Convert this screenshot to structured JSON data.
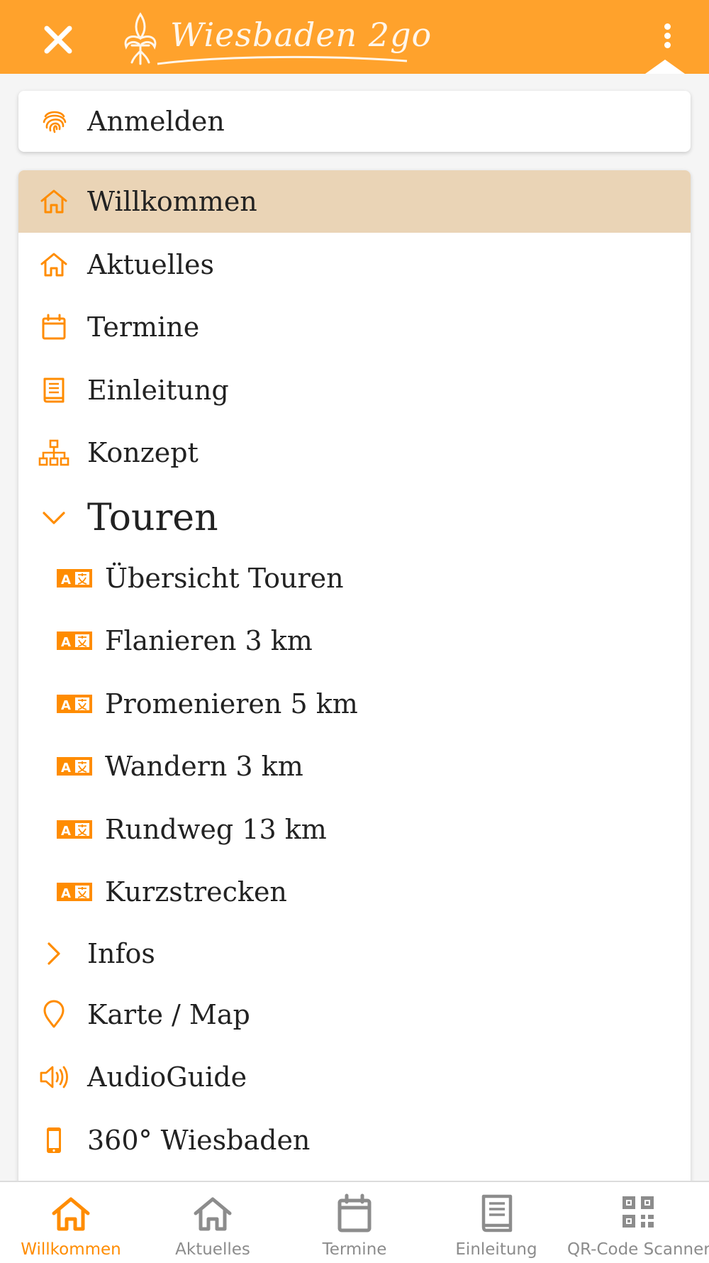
{
  "colors": {
    "accent": "#ff8c00",
    "header": "#ffa22c",
    "active_item": "#ead4b6",
    "tab_inactive": "#8c8c8c"
  },
  "header": {
    "logo_text": "Wiesbaden 2go",
    "close_icon": "close-icon",
    "menu_icon": "more-vertical-icon"
  },
  "login": {
    "label": "Anmelden",
    "icon": "fingerprint-icon"
  },
  "menu": {
    "items": [
      {
        "label": "Willkommen",
        "icon": "home-icon",
        "active": true
      },
      {
        "label": "Aktuelles",
        "icon": "home-icon"
      },
      {
        "label": "Termine",
        "icon": "calendar-icon"
      },
      {
        "label": "Einleitung",
        "icon": "book-icon"
      },
      {
        "label": "Konzept",
        "icon": "sitemap-icon"
      }
    ],
    "touren": {
      "label": "Touren",
      "icon": "chevron-down-icon",
      "expanded": true,
      "children": [
        {
          "label": "Übersicht Touren",
          "icon": "translate-icon"
        },
        {
          "label": "Flanieren 3 km",
          "icon": "translate-icon"
        },
        {
          "label": "Promenieren 5 km",
          "icon": "translate-icon"
        },
        {
          "label": "Wandern 3 km",
          "icon": "translate-icon"
        },
        {
          "label": "Rundweg 13 km",
          "icon": "translate-icon"
        },
        {
          "label": "Kurzstrecken",
          "icon": "translate-icon"
        }
      ]
    },
    "infos": {
      "label": "Infos",
      "icon": "chevron-right-icon",
      "expanded": false
    },
    "more_items": [
      {
        "label": "Karte / Map",
        "icon": "map-pin-icon"
      },
      {
        "label": "AudioGuide",
        "icon": "speaker-icon"
      },
      {
        "label": "360° Wiesbaden",
        "icon": "phone-icon"
      }
    ]
  },
  "tabbar": {
    "tabs": [
      {
        "label": "Willkommen",
        "icon": "home-icon",
        "active": true
      },
      {
        "label": "Aktuelles",
        "icon": "home-icon"
      },
      {
        "label": "Termine",
        "icon": "calendar-icon"
      },
      {
        "label": "Einleitung",
        "icon": "book-icon"
      },
      {
        "label": "QR-Code Scanner",
        "icon": "qr-code-icon"
      }
    ]
  }
}
